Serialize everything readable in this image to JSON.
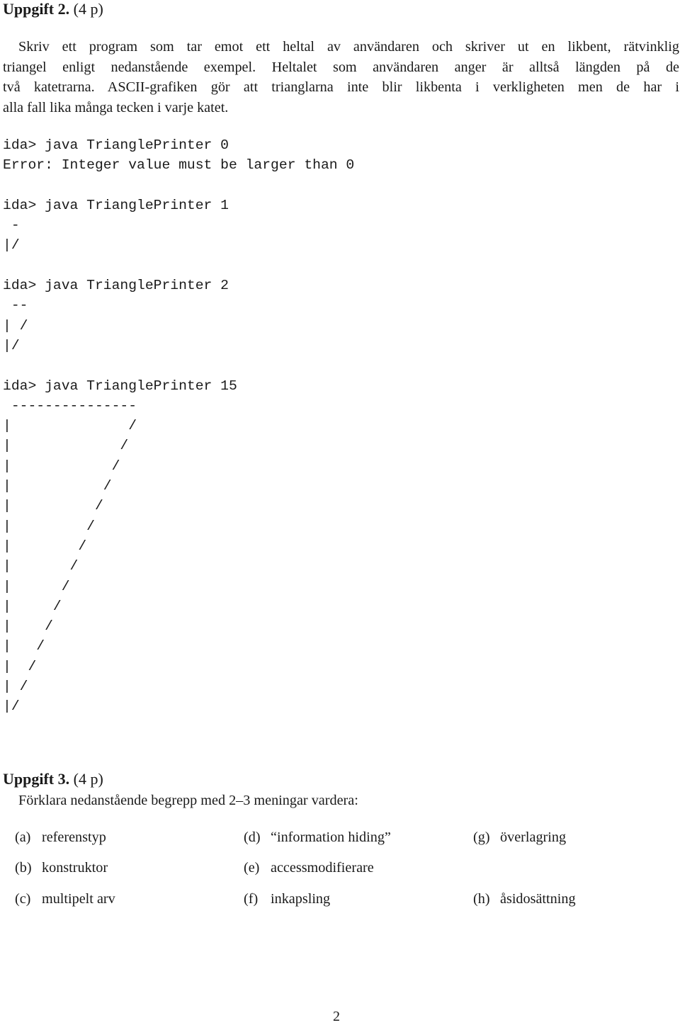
{
  "task2": {
    "title": "Uppgift 2.",
    "points": "(4 p)",
    "paragraph_lines": [
      "Skriv ett program som tar emot ett heltal av användaren och skriver ut en likbent, rätvinklig",
      "triangel enligt nedanstående exempel. Heltalet som användaren anger är alltså längden på de",
      "två katetrarna. ASCII-grafiken gör att trianglarna inte blir likbenta i verkligheten men de har i",
      "alla fall lika många tecken i varje katet."
    ],
    "terminal_lines": [
      "ida> java TrianglePrinter 0",
      "Error: Integer value must be larger than 0",
      "",
      "ida> java TrianglePrinter 1",
      " -",
      "|/",
      "",
      "ida> java TrianglePrinter 2",
      " --",
      "| /",
      "|/",
      "",
      "ida> java TrianglePrinter 15",
      " ---------------",
      "|              /",
      "|             /",
      "|            /",
      "|           /",
      "|          /",
      "|         /",
      "|        /",
      "|       /",
      "|      /",
      "|     /",
      "|    /",
      "|   /",
      "|  /",
      "| /",
      "|/"
    ]
  },
  "task3": {
    "title": "Uppgift 3.",
    "points": "(4 p)",
    "intro": "Förklara nedanstående begrepp med 2–3 meningar vardera:",
    "items": [
      {
        "label": "(a)",
        "text": "referenstyp"
      },
      {
        "label": "(b)",
        "text": "konstruktor"
      },
      {
        "label": "(c)",
        "text": "multipelt arv"
      },
      {
        "label": "(d)",
        "text": "“information hiding”"
      },
      {
        "label": "(e)",
        "text": "accessmodifierare"
      },
      {
        "label": "(f)",
        "text": "inkapsling"
      },
      {
        "label": "(g)",
        "text": "överlagring"
      },
      {
        "label": "(h)",
        "text": "åsidosättning"
      }
    ]
  },
  "page_number": "2"
}
